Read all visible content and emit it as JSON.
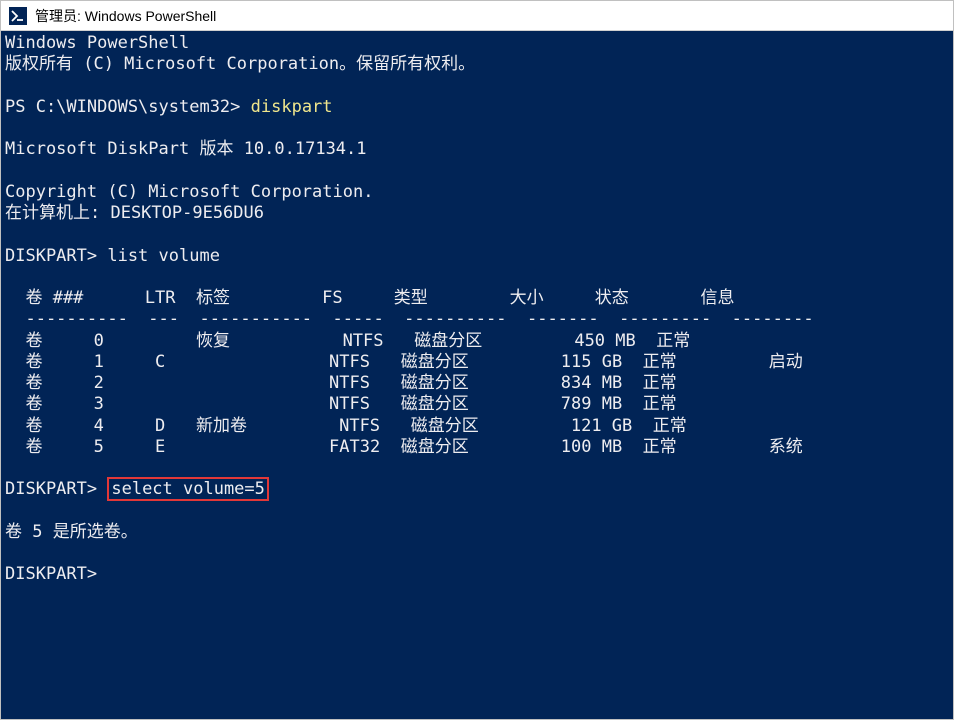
{
  "titlebar": {
    "title": "管理员: Windows PowerShell"
  },
  "terminal": {
    "line1": "Windows PowerShell",
    "line2": "版权所有 (C) Microsoft Corporation。保留所有权利。",
    "prompt1_path": "PS C:\\WINDOWS\\system32> ",
    "prompt1_cmd": "diskpart",
    "diskpart_version": "Microsoft DiskPart 版本 10.0.17134.1",
    "copyright": "Copyright (C) Microsoft Corporation.",
    "computer": "在计算机上: DESKTOP-9E56DU6",
    "prompt2": "DISKPART> list volume",
    "table_header": "  卷 ###      LTR  标签         FS     类型        大小     状态       信息",
    "table_divider": "  ----------  ---  -----------  -----  ----------  -------  ---------  --------",
    "row0": "  卷     0         恢复           NTFS   磁盘分区         450 MB  正常",
    "row1": "  卷     1     C                NTFS   磁盘分区         115 GB  正常         启动",
    "row2": "  卷     2                      NTFS   磁盘分区         834 MB  正常",
    "row3": "  卷     3                      NTFS   磁盘分区         789 MB  正常",
    "row4": "  卷     4     D   新加卷         NTFS   磁盘分区         121 GB  正常",
    "row5": "  卷     5     E                FAT32  磁盘分区         100 MB  正常         系统",
    "prompt3_prefix": "DISKPART> ",
    "prompt3_cmd": "select volume=5",
    "selected_msg": "卷 5 是所选卷。",
    "prompt4": "DISKPART>"
  },
  "chart_data": {
    "type": "table",
    "title": "list volume",
    "columns": [
      "卷 ###",
      "LTR",
      "标签",
      "FS",
      "类型",
      "大小",
      "状态",
      "信息"
    ],
    "rows": [
      {
        "vol": "卷 0",
        "ltr": "",
        "label": "恢复",
        "fs": "NTFS",
        "type": "磁盘分区",
        "size": "450 MB",
        "status": "正常",
        "info": ""
      },
      {
        "vol": "卷 1",
        "ltr": "C",
        "label": "",
        "fs": "NTFS",
        "type": "磁盘分区",
        "size": "115 GB",
        "status": "正常",
        "info": "启动"
      },
      {
        "vol": "卷 2",
        "ltr": "",
        "label": "",
        "fs": "NTFS",
        "type": "磁盘分区",
        "size": "834 MB",
        "status": "正常",
        "info": ""
      },
      {
        "vol": "卷 3",
        "ltr": "",
        "label": "",
        "fs": "NTFS",
        "type": "磁盘分区",
        "size": "789 MB",
        "status": "正常",
        "info": ""
      },
      {
        "vol": "卷 4",
        "ltr": "D",
        "label": "新加卷",
        "fs": "NTFS",
        "type": "磁盘分区",
        "size": "121 GB",
        "status": "正常",
        "info": ""
      },
      {
        "vol": "卷 5",
        "ltr": "E",
        "label": "",
        "fs": "FAT32",
        "type": "磁盘分区",
        "size": "100 MB",
        "status": "正常",
        "info": "系统"
      }
    ]
  }
}
